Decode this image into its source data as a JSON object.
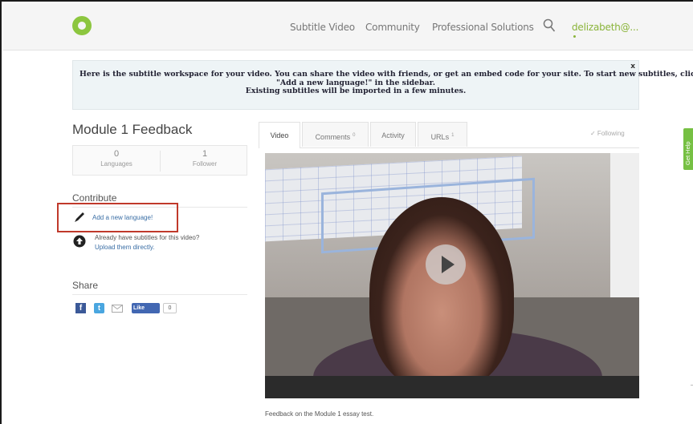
{
  "nav": {
    "links": [
      "Subtitle Video",
      "Community",
      "Professional Solutions"
    ],
    "user": "delizabeth@..."
  },
  "notice": {
    "lines": [
      "Here is the subtitle workspace for your video. You can share the video with friends, or get an embed code for your site. To start new subtitles, click",
      "\"Add a new language!\" in the sidebar.",
      "Existing subtitles will be imported in a few minutes."
    ],
    "close": "x"
  },
  "video_info": {
    "title": "Module 1 Feedback",
    "stats": [
      {
        "value": "0",
        "label": "Languages"
      },
      {
        "value": "1",
        "label": "Follower"
      }
    ]
  },
  "contribute": {
    "heading": "Contribute",
    "add_language": "Add a new language!",
    "already": "Already have subtitles for this video?",
    "upload": "Upload them directly."
  },
  "share": {
    "heading": "Share",
    "facebook": "f",
    "twitter": "t",
    "like": "Like",
    "like_count": "0"
  },
  "tabs": [
    {
      "label": "Video",
      "count": ""
    },
    {
      "label": "Comments",
      "count": "0"
    },
    {
      "label": "Activity",
      "count": ""
    },
    {
      "label": "URLs",
      "count": "1"
    }
  ],
  "following": "✓ Following",
  "caption": "Feedback on the Module 1 essay test.",
  "get_help": "Get Help",
  "colors": {
    "accent_green": "#8ab43a",
    "link_blue": "#3a6ea5",
    "highlight_red": "#c0392b"
  }
}
